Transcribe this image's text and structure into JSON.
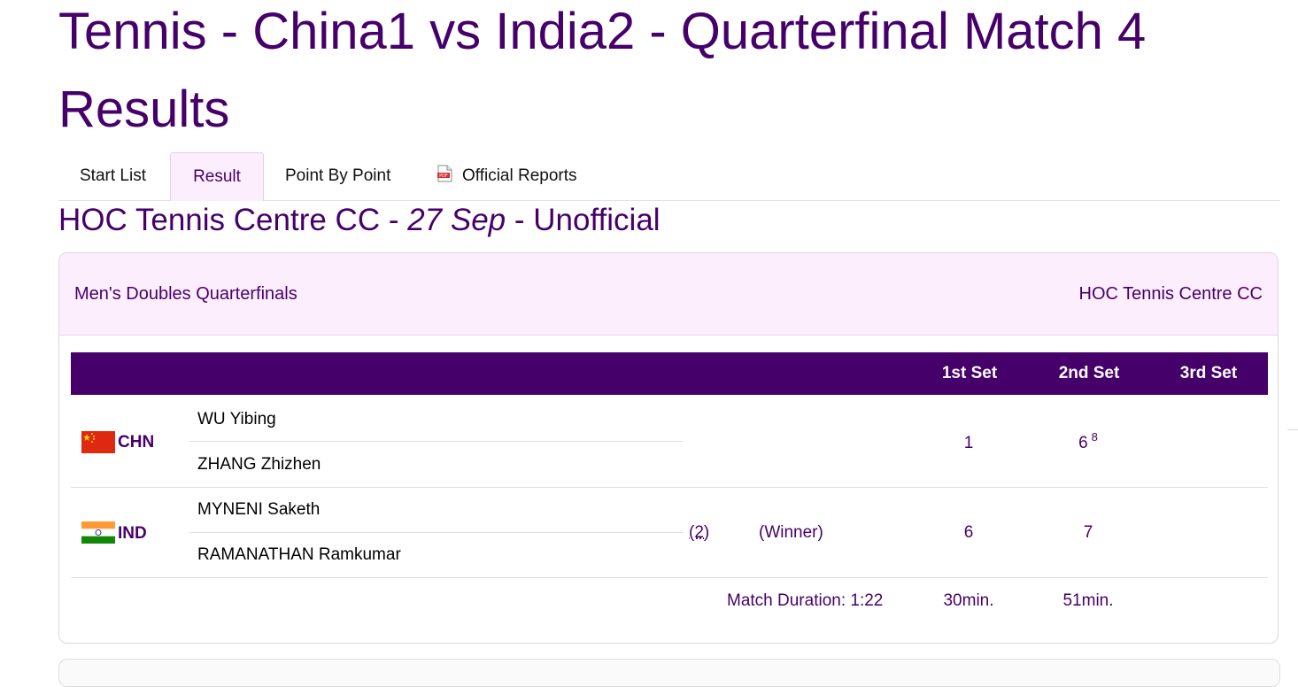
{
  "title": "Tennis - China1 vs India2 - Quarterfinal Match 4 Results",
  "tabs": [
    {
      "label": "Start List"
    },
    {
      "label": "Result"
    },
    {
      "label": "Point By Point"
    },
    {
      "label": "Official Reports",
      "icon": "pdf-icon"
    }
  ],
  "subtitle": {
    "venue": "HOC Tennis Centre CC - ",
    "date": "27 Sep",
    "status": " - Unofficial"
  },
  "card": {
    "event": "Men's Doubles Quarterfinals",
    "venue": "HOC Tennis Centre CC"
  },
  "table": {
    "headers": [
      "1st Set",
      "2nd Set",
      "3rd Set"
    ],
    "teams": [
      {
        "code": "CHN",
        "flag": "china-flag",
        "players": [
          "WU Yibing",
          "ZHANG Zhizhen"
        ],
        "seed": "",
        "result": "",
        "sets": [
          "1",
          "6",
          ""
        ],
        "tiebreaks": [
          "",
          "8",
          ""
        ]
      },
      {
        "code": "IND",
        "flag": "india-flag",
        "players": [
          "MYNENI Saketh",
          "RAMANATHAN Ramkumar"
        ],
        "seed": "(2)",
        "result": "(Winner)",
        "sets": [
          "6",
          "7",
          ""
        ],
        "tiebreaks": [
          "",
          "",
          ""
        ]
      }
    ],
    "footer": {
      "duration": "Match Duration: 1:22",
      "set_times": [
        "30min.",
        "51min.",
        ""
      ]
    }
  },
  "colors": {
    "accent": "#46006a",
    "header_bg": "#fdeefd"
  }
}
